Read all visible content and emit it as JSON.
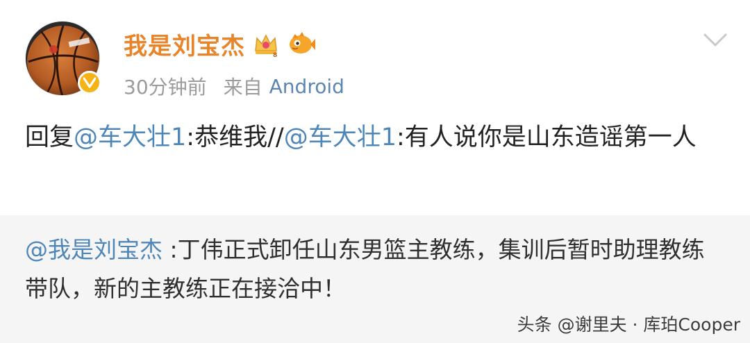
{
  "post": {
    "username": "我是刘宝杰",
    "time": "30分钟前",
    "from_prefix": "来自",
    "source": "Android",
    "content": {
      "prefix": "回复",
      "mention1": "@车大壮1",
      "text1": ":恭维我//",
      "mention2": "@车大壮1",
      "text2": ":有人说你是山东造谣第一人"
    }
  },
  "repost": {
    "mention": "@我是刘宝杰",
    "text": " :丁伟正式卸任山东男篮主教练，集训后暂时助理教练带队，新的主教练正在接洽中！"
  },
  "watermark": "头条 @谢里夫 · 库珀Cooper",
  "icons": {
    "avatar": "basketball-avatar",
    "verified": "verified-v-icon",
    "crown": "crown-badge-icon",
    "fish": "fish-badge-icon",
    "dropdown": "chevron-down-icon"
  },
  "colors": {
    "username": "#e8852b",
    "mention": "#4e86b8",
    "meta": "#9b9b9b",
    "repost_bg": "#f5f5f5",
    "verified": "#f5b316"
  }
}
